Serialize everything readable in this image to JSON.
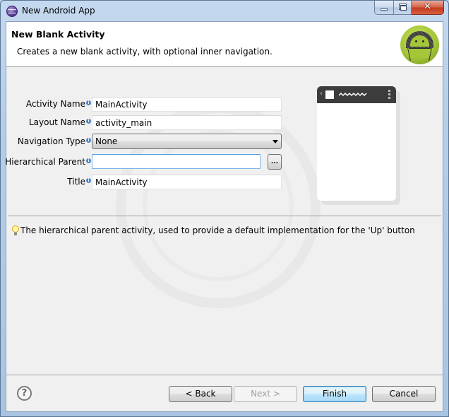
{
  "window": {
    "title": "New Android App",
    "controls": {
      "minimize": "minimize",
      "maximize": "maximize",
      "close": "✕"
    }
  },
  "header": {
    "title": "New Blank Activity",
    "description": "Creates a new blank activity, with optional inner navigation.",
    "logo_icon": "android-logo-icon"
  },
  "form": {
    "fields": [
      {
        "label": "Activity Name",
        "value": "MainActivity",
        "type": "text"
      },
      {
        "label": "Layout Name",
        "value": "activity_main",
        "type": "text"
      },
      {
        "label": "Navigation Type",
        "value": "None",
        "type": "select"
      },
      {
        "label": "Hierarchical Parent",
        "value": "",
        "type": "text",
        "focused": true
      },
      {
        "label": "Title",
        "value": "MainActivity",
        "type": "text"
      }
    ],
    "info_glyph": "i",
    "browse_label": "..."
  },
  "preview": {
    "up_caret": "‹"
  },
  "hint": {
    "icon": "lightbulb-icon",
    "text": "The hierarchical parent activity, used to provide a default implementation for the 'Up' button"
  },
  "footer": {
    "help_label": "?",
    "buttons": {
      "back": "< Back",
      "next": "Next >",
      "finish": "Finish",
      "cancel": "Cancel"
    },
    "next_enabled": false,
    "default_button": "finish"
  },
  "colors": {
    "accent_focus": "#569de5",
    "android_green": "#a4c639",
    "actionbar": "#3c3c3c",
    "info_icon": "#4f86c6"
  }
}
